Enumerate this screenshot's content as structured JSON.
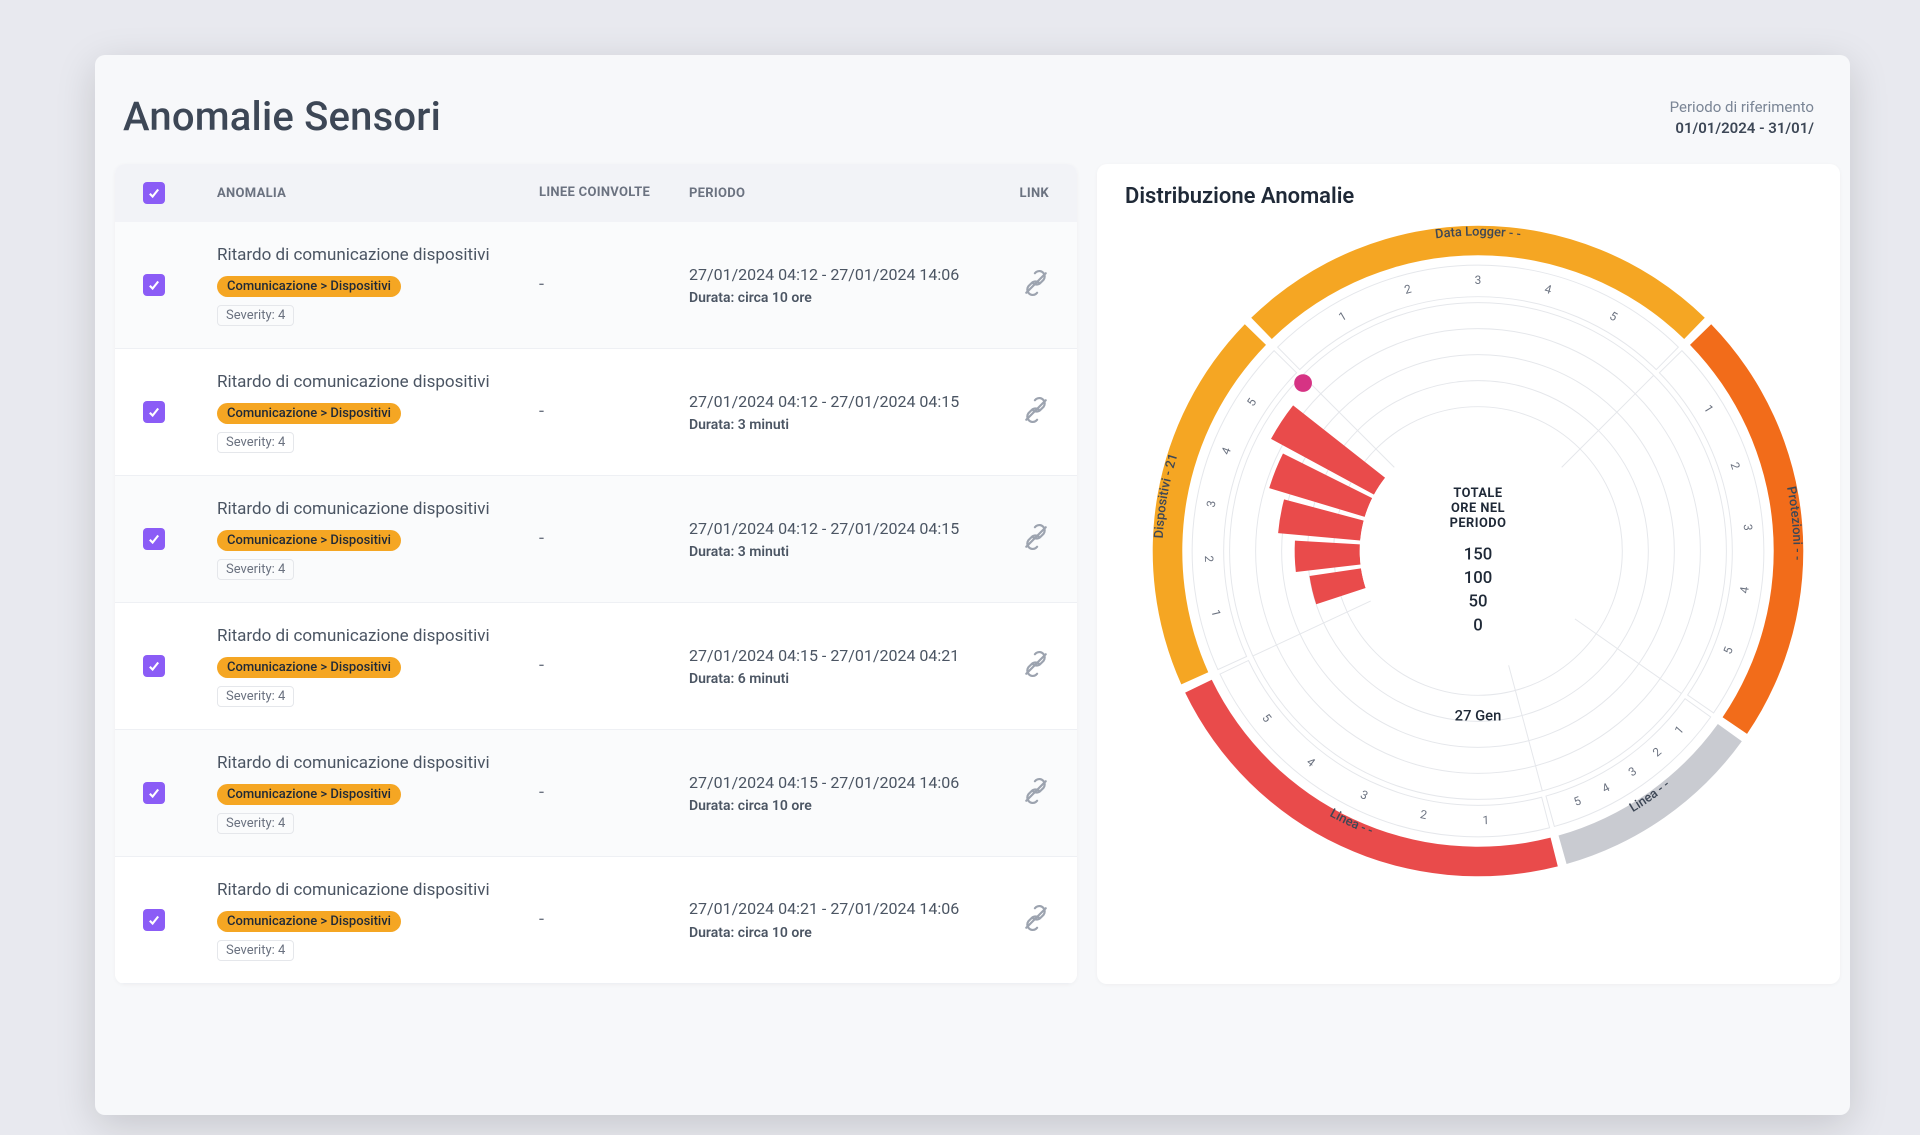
{
  "header": {
    "title": "Anomalie Sensori",
    "period_label": "Periodo di riferimento",
    "period_value": "01/01/2024 - 31/01/"
  },
  "table": {
    "columns": {
      "anomalia": "ANOMALIA",
      "linee": "LINEE COINVOLTE",
      "periodo": "PERIODO",
      "link": "LINK"
    },
    "severity_prefix": "Severity: ",
    "duration_prefix": "Durata: ",
    "rows": [
      {
        "title": "Ritardo di comunicazione dispositivi",
        "badge": "Comunicazione > Dispositivi",
        "severity": "4",
        "lines": "-",
        "period": "27/01/2024 04:12 - 27/01/2024 14:06",
        "duration": "circa 10 ore"
      },
      {
        "title": "Ritardo di comunicazione dispositivi",
        "badge": "Comunicazione > Dispositivi",
        "severity": "4",
        "lines": "-",
        "period": "27/01/2024 04:12 - 27/01/2024 04:15",
        "duration": "3 minuti"
      },
      {
        "title": "Ritardo di comunicazione dispositivi",
        "badge": "Comunicazione > Dispositivi",
        "severity": "4",
        "lines": "-",
        "period": "27/01/2024 04:12 - 27/01/2024 04:15",
        "duration": "3 minuti"
      },
      {
        "title": "Ritardo di comunicazione dispositivi",
        "badge": "Comunicazione > Dispositivi",
        "severity": "4",
        "lines": "-",
        "period": "27/01/2024 04:15 - 27/01/2024 04:21",
        "duration": "6 minuti"
      },
      {
        "title": "Ritardo di comunicazione dispositivi",
        "badge": "Comunicazione > Dispositivi",
        "severity": "4",
        "lines": "-",
        "period": "27/01/2024 04:15 - 27/01/2024 14:06",
        "duration": "circa 10 ore"
      },
      {
        "title": "Ritardo di comunicazione dispositivi",
        "badge": "Comunicazione > Dispositivi",
        "severity": "4",
        "lines": "-",
        "period": "27/01/2024 04:21 - 27/01/2024 14:06",
        "duration": "circa 10 ore"
      }
    ]
  },
  "chart": {
    "title": "Distribuzione Anomalie",
    "center_label": "TOTALE ORE NEL PERIODO",
    "center_scale": [
      "150",
      "100",
      "50",
      "0"
    ],
    "center_date": "27 Gen",
    "ring_labels": {
      "top": "Data Logger - -",
      "right": "Protezioni - -",
      "bottom_right": "Linea - -",
      "bottom_left": "Linea - -",
      "left": "Dispositivi - 21"
    }
  },
  "colors": {
    "accent": "#8b5cf6",
    "badge": "#f5a623",
    "ring_yellow": "#f5a623",
    "ring_orange": "#f26c1a",
    "ring_red": "#e94b4b",
    "ring_grey": "#c9cbd1",
    "bar_red": "#e94b4b",
    "dot_pink": "#d63384"
  },
  "chart_data": {
    "type": "sunburst",
    "title": "Distribuzione Anomalie",
    "center_metric": "Totale ore nel periodo",
    "radial_scale": [
      0,
      50,
      100,
      150
    ],
    "outer_ring_segments": [
      {
        "label": "Data Logger - -",
        "color": "#f5a623",
        "span_deg": 90
      },
      {
        "label": "Protezioni - -",
        "color": "#f26c1a",
        "span_deg": 80
      },
      {
        "label": "Linea - -",
        "color": "#c9cbd1",
        "span_deg": 40
      },
      {
        "label": "Linea - -",
        "color": "#e94b4b",
        "span_deg": 80
      },
      {
        "label": "Dispositivi - 21",
        "color": "#f5a623",
        "span_deg": 70
      }
    ],
    "slot_ticks_per_segment": [
      1,
      2,
      3,
      4,
      5
    ],
    "bars": [
      {
        "segment": "Dispositivi - 21",
        "slot": 1,
        "value": 60
      },
      {
        "segment": "Dispositivi - 21",
        "slot": 2,
        "value": 75
      },
      {
        "segment": "Dispositivi - 21",
        "slot": 3,
        "value": 95
      },
      {
        "segment": "Dispositivi - 21",
        "slot": 4,
        "value": 115
      },
      {
        "segment": "Dispositivi - 21",
        "slot": 5,
        "value": 135
      }
    ],
    "markers": [
      {
        "segment": "Dispositivi - 21",
        "slot_after_last": true,
        "value": 150,
        "color": "#d63384"
      }
    ],
    "date_label": "27 Gen"
  }
}
